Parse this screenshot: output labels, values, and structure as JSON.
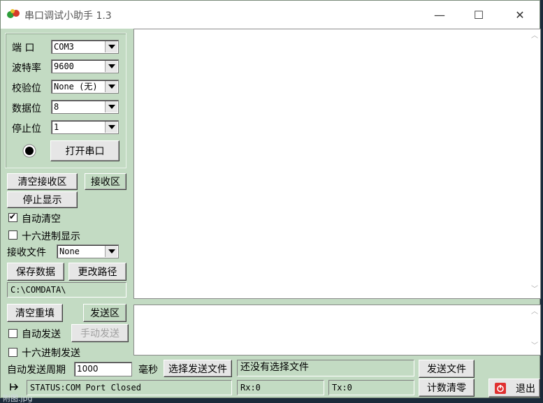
{
  "window": {
    "title": "串口调试小助手 1.3",
    "minimize": "—",
    "maximize": "☐",
    "close": "✕"
  },
  "port_settings": {
    "port_label": "端  口",
    "port_value": "COM3",
    "baud_label": "波特率",
    "baud_value": "9600",
    "parity_label": "校验位",
    "parity_value": "None (无)",
    "databits_label": "数据位",
    "databits_value": "8",
    "stopbits_label": "停止位",
    "stopbits_value": "1",
    "open_button": "打开串口"
  },
  "receive": {
    "clear_button": "清空接收区",
    "area_label": "接收区",
    "stop_display_button": "停止显示",
    "auto_clear_label": "自动清空",
    "auto_clear_checked": true,
    "hex_display_label": "十六进制显示",
    "hex_display_checked": false,
    "file_label": "接收文件",
    "file_value": "None",
    "save_button": "保存数据",
    "change_path_button": "更改路径",
    "path": "C:\\COMDATA\\"
  },
  "send": {
    "clear_button": "清空重填",
    "area_label": "发送区",
    "auto_send_label": "自动发送",
    "auto_send_checked": false,
    "manual_send_button": "手动发送",
    "hex_send_label": "十六进制发送",
    "hex_send_checked": false,
    "period_label": "自动发送周期",
    "period_value": "1000",
    "period_unit": "毫秒",
    "choose_file_button": "选择发送文件",
    "file_status": "还没有选择文件",
    "send_file_button": "发送文件"
  },
  "status": {
    "text": "STATUS:COM Port Closed",
    "rx": "Rx:0",
    "tx": "Tx:0",
    "reset_button": "计数清零",
    "exit_button": "退出"
  },
  "colors": {
    "panel_bg": "#c3dbc3",
    "exit_icon": "#e03030",
    "indicator": "#000000"
  },
  "behind_text": "附图.jpg"
}
